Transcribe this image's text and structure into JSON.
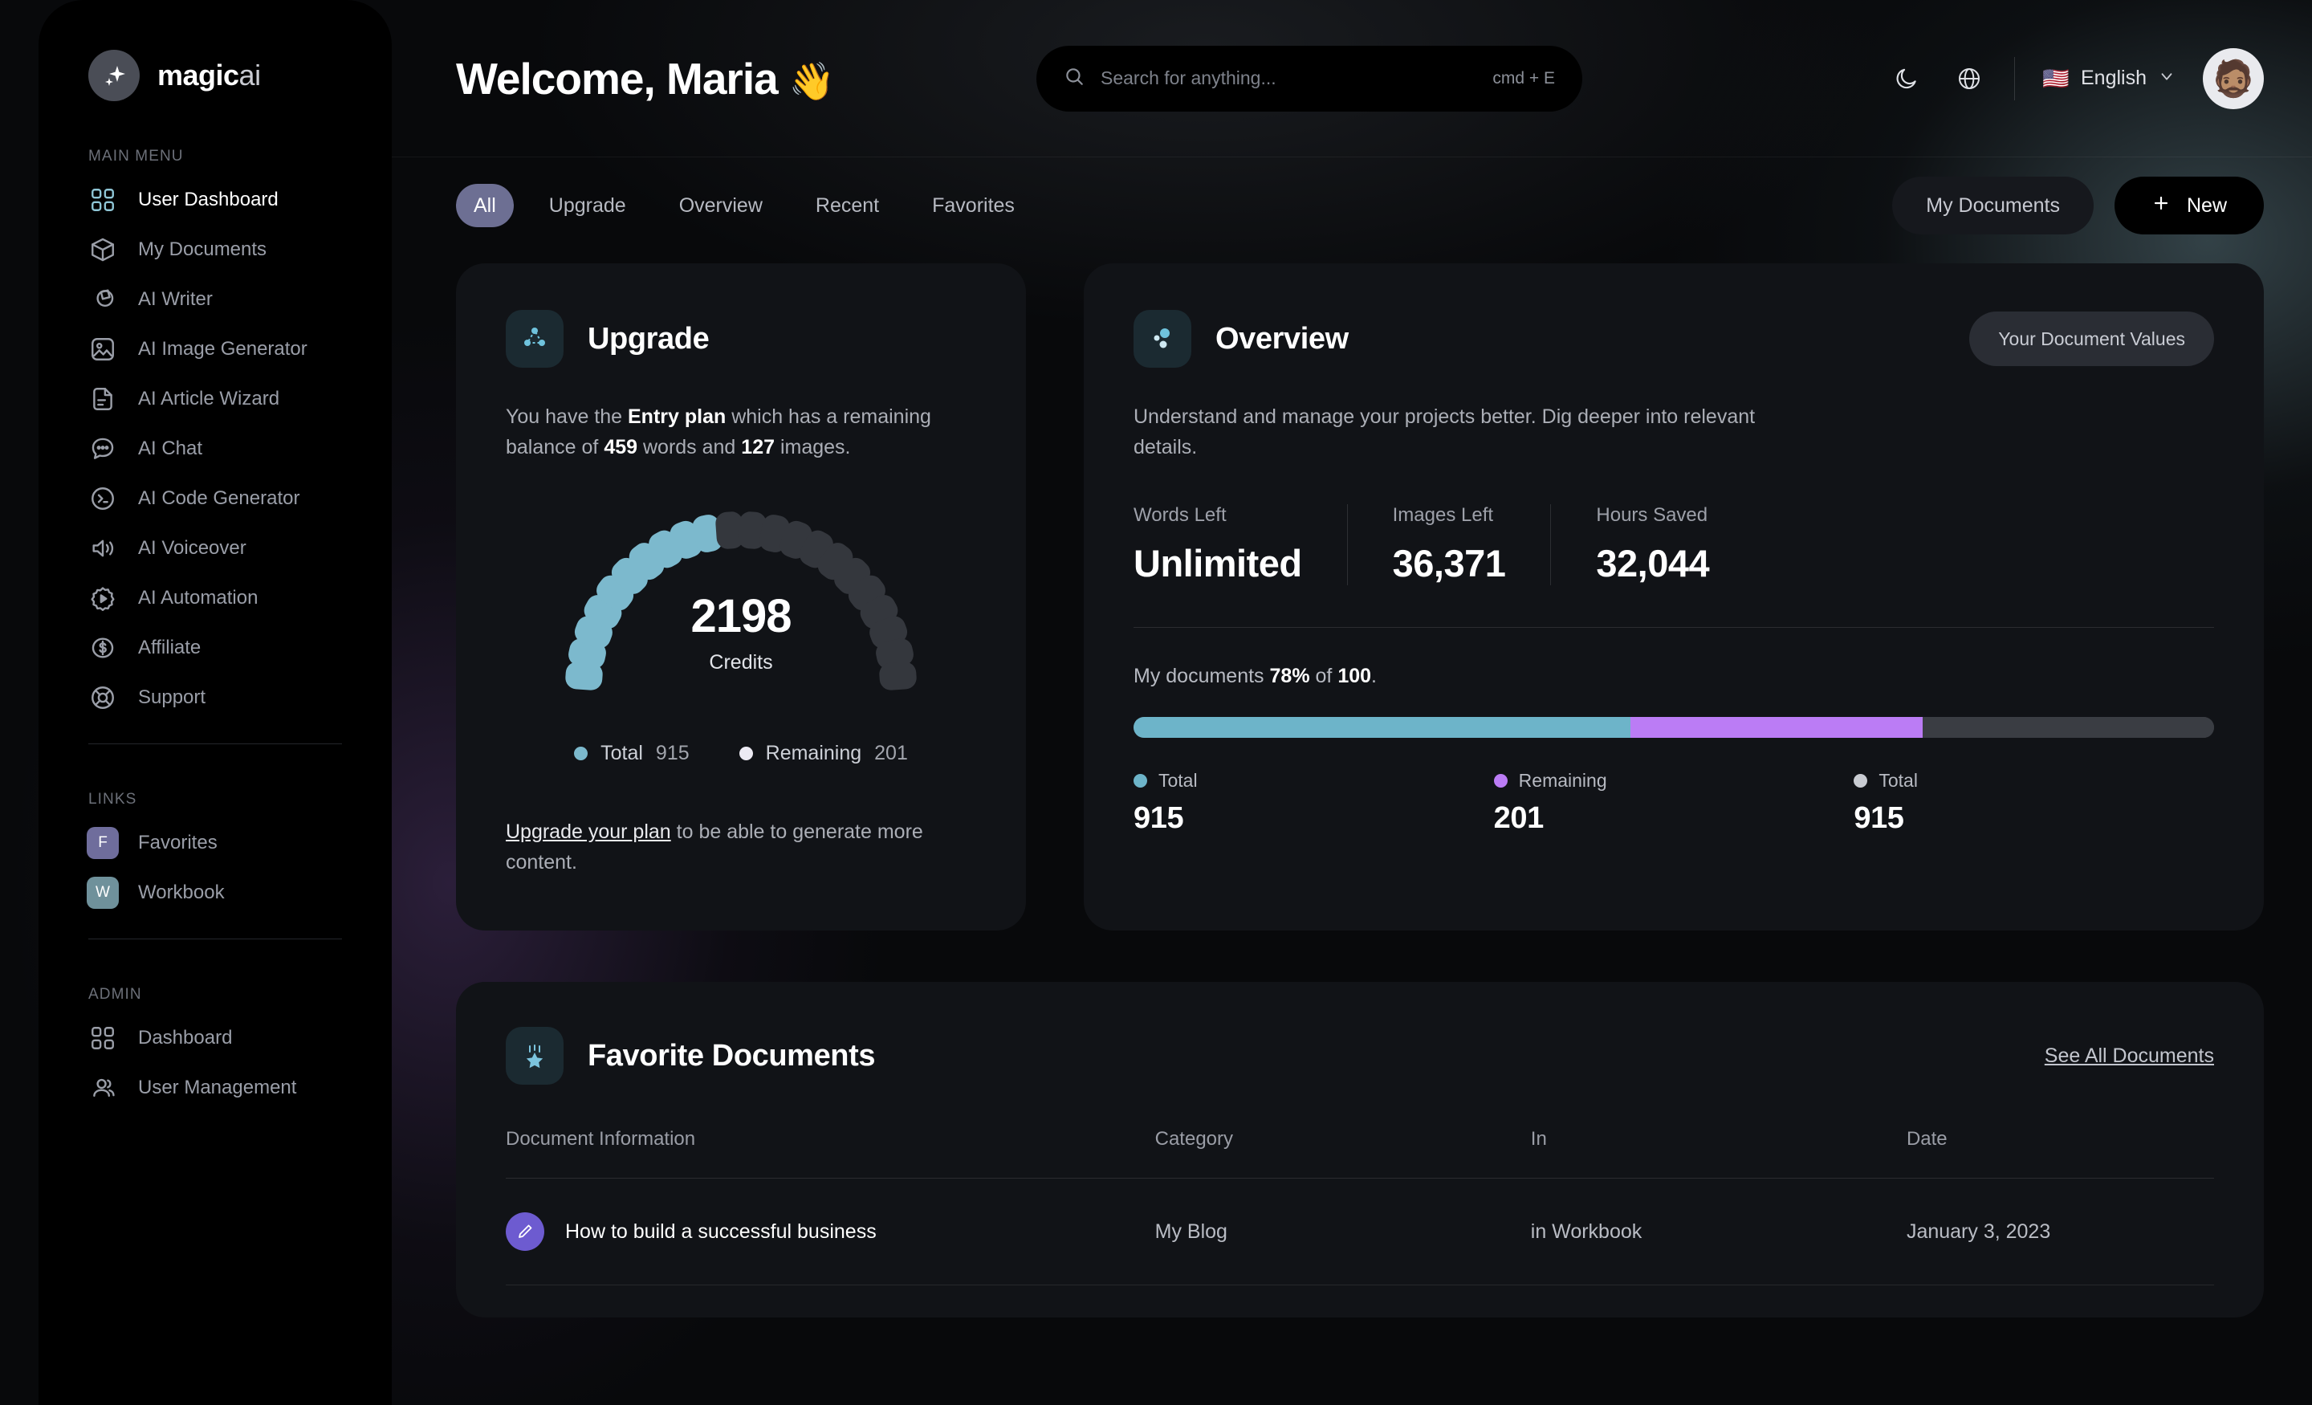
{
  "brand": {
    "name_bold": "magic",
    "name_light": "ai",
    "logo_icon": "sparkle-icon"
  },
  "sidebar": {
    "main_label": "MAIN MENU",
    "links_label": "LINKS",
    "admin_label": "ADMIN",
    "main_items": [
      {
        "label": "User Dashboard",
        "icon": "grid-icon",
        "active": true
      },
      {
        "label": "My Documents",
        "icon": "cube-icon",
        "active": false
      },
      {
        "label": "AI Writer",
        "icon": "shapes-icon",
        "active": false
      },
      {
        "label": "AI Image Generator",
        "icon": "image-icon",
        "active": false
      },
      {
        "label": "AI Article Wizard",
        "icon": "document-icon",
        "active": false
      },
      {
        "label": "AI Chat",
        "icon": "chat-bubble-icon",
        "active": false
      },
      {
        "label": "AI Code Generator",
        "icon": "terminal-icon",
        "active": false
      },
      {
        "label": "AI Voiceover",
        "icon": "speaker-icon",
        "active": false
      },
      {
        "label": "AI Automation",
        "icon": "gear-play-icon",
        "active": false
      },
      {
        "label": "Affiliate",
        "icon": "dollar-circle-icon",
        "active": false
      },
      {
        "label": "Support",
        "icon": "lifebuoy-icon",
        "active": false
      }
    ],
    "link_items": [
      {
        "label": "Favorites",
        "badge": "F",
        "color": "#6f6d9c"
      },
      {
        "label": "Workbook",
        "badge": "W",
        "color": "#6f919b"
      }
    ],
    "admin_items": [
      {
        "label": "Dashboard",
        "icon": "grid-icon"
      },
      {
        "label": "User Management",
        "icon": "users-icon"
      }
    ]
  },
  "topbar": {
    "welcome": "Welcome, Maria",
    "wave_emoji": "👋",
    "search_placeholder": "Search for anything...",
    "search_value": "",
    "search_shortcut": "cmd + E",
    "dark_mode_icon": "moon-icon",
    "globe_icon": "globe-icon",
    "language": "English",
    "language_flag": "🇺🇸",
    "chevron_icon": "chevron-down-icon",
    "avatar_emoji": "🧔🏽"
  },
  "tabs": [
    {
      "label": "All",
      "active": true
    },
    {
      "label": "Upgrade",
      "active": false
    },
    {
      "label": "Overview",
      "active": false
    },
    {
      "label": "Recent",
      "active": false
    },
    {
      "label": "Favorites",
      "active": false
    }
  ],
  "actions": {
    "my_documents": "My Documents",
    "new": "New",
    "plus_icon": "plus-icon"
  },
  "upgrade": {
    "title": "Upgrade",
    "icon": "upgrade-nodes-icon",
    "desc_1": "You have the ",
    "plan": "Entry plan",
    "desc_2": " which has a remaining balance of ",
    "words": "459",
    "desc_3": " words and ",
    "images": "127",
    "desc_4": " images.",
    "gauge_value": "2198",
    "gauge_label": "Credits",
    "legend": [
      {
        "label": "Total",
        "value": "915",
        "color": "#7cb9cd"
      },
      {
        "label": "Remaining",
        "value": "201",
        "color": "#eceaf3"
      }
    ],
    "note_link": "Upgrade your plan",
    "note_rest": " to be able to generate more content."
  },
  "overview": {
    "title": "Overview",
    "icon": "overview-dots-icon",
    "button": "Your Document Values",
    "desc": "Understand and manage your projects better. Dig deeper into relevant details.",
    "stats": [
      {
        "label": "Words Left",
        "value": "Unlimited"
      },
      {
        "label": "Images Left",
        "value": "36,371"
      },
      {
        "label": "Hours Saved",
        "value": "32,044"
      }
    ],
    "docline_1": "My documents ",
    "docline_pct": "78%",
    "docline_2": " of ",
    "docline_total": "100",
    "docline_3": ".",
    "bar_legend": [
      {
        "label": "Total",
        "value": "915",
        "color": "#6db4c9"
      },
      {
        "label": "Remaining",
        "value": "201",
        "color": "#bb7cf5"
      },
      {
        "label": "Total",
        "value": "915",
        "color": "#c9ccd2"
      }
    ]
  },
  "favorites": {
    "title": "Favorite Documents",
    "icon": "star-badge-icon",
    "see_all": "See All Documents",
    "columns": [
      "Document Information",
      "Category",
      "In",
      "Date"
    ],
    "rows": [
      {
        "title": "How to build a successful business",
        "icon": "pen-icon",
        "category": "My Blog",
        "in": "in Workbook",
        "date": "January 3, 2023"
      }
    ]
  },
  "chart_data": [
    {
      "type": "pie",
      "title": "Credits gauge",
      "center_value": 2198,
      "center_label": "Credits",
      "segments_total": 22,
      "segments_filled": 10,
      "categories": [
        "Total",
        "Remaining"
      ],
      "values": [
        915,
        201
      ],
      "colors": [
        "#7cb9cd",
        "#eceaf3"
      ],
      "legend": "below",
      "grid": false
    },
    {
      "type": "bar",
      "title": "My documents 78% of 100.",
      "orientation": "horizontal-stacked",
      "categories": [
        "Total",
        "Remaining",
        "Total"
      ],
      "values": [
        915,
        201,
        915
      ],
      "segment_percent": [
        46,
        27,
        27
      ],
      "colors": [
        "#6db4c9",
        "#bb7cf5",
        "#3a3d43"
      ],
      "xlabel": "",
      "ylabel": "",
      "grid": false,
      "legend": "below"
    }
  ]
}
